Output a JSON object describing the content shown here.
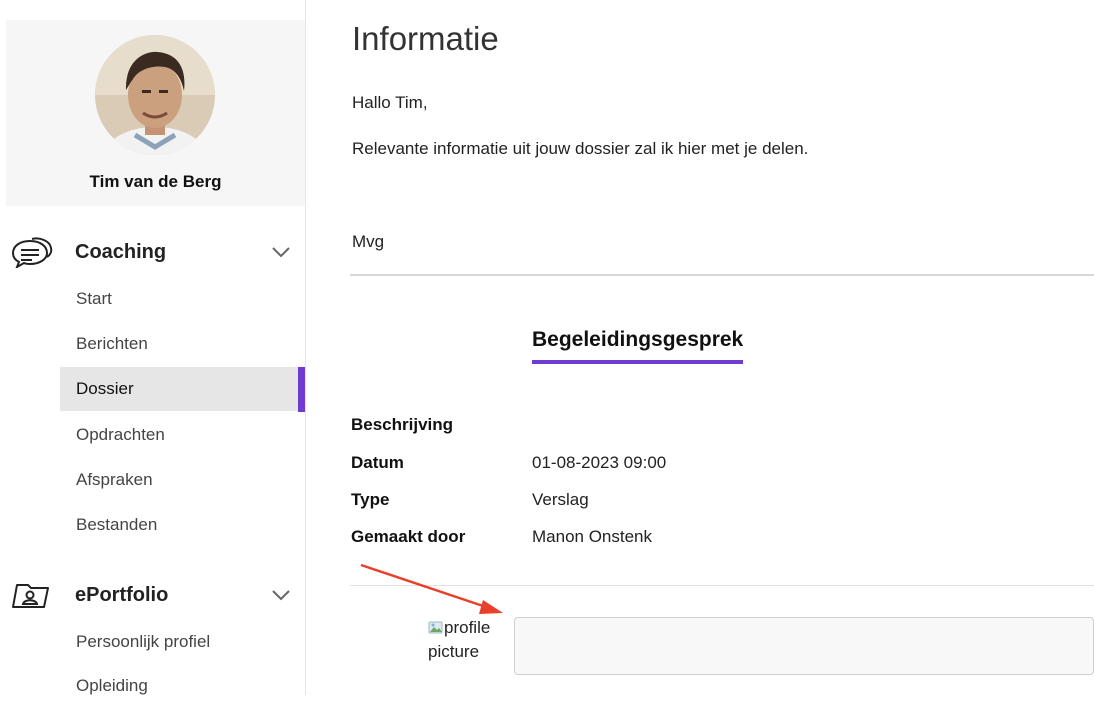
{
  "sidebar": {
    "profile": {
      "name": "Tim van de Berg"
    },
    "sections": [
      {
        "label": "Coaching",
        "icon": "chat-bubbles-icon",
        "items": [
          {
            "label": "Start"
          },
          {
            "label": "Berichten"
          },
          {
            "label": "Dossier",
            "active": true
          },
          {
            "label": "Opdrachten"
          },
          {
            "label": "Afspraken"
          },
          {
            "label": "Bestanden"
          }
        ]
      },
      {
        "label": "ePortfolio",
        "icon": "id-card-folder-icon",
        "items": [
          {
            "label": "Persoonlijk profiel"
          },
          {
            "label": "Opleiding"
          }
        ]
      }
    ]
  },
  "main": {
    "title": "Informatie",
    "greeting": "Hallo Tim,",
    "intro": "Relevante informatie uit jouw dossier zal ik hier met je delen.",
    "signoff": "Mvg",
    "record": {
      "title": "Begeleidingsgesprek",
      "fields": [
        {
          "label": "Beschrijving",
          "value": ""
        },
        {
          "label": "Datum",
          "value": "01-08-2023 09:00"
        },
        {
          "label": "Type",
          "value": "Verslag"
        },
        {
          "label": "Gemaakt door",
          "value": "Manon Onstenk"
        }
      ]
    },
    "comment": {
      "avatar_alt_line1": "profile",
      "avatar_alt_line2": "picture",
      "value": ""
    }
  },
  "colors": {
    "accent": "#6f3bd1",
    "annotation_arrow": "#e8402a"
  }
}
